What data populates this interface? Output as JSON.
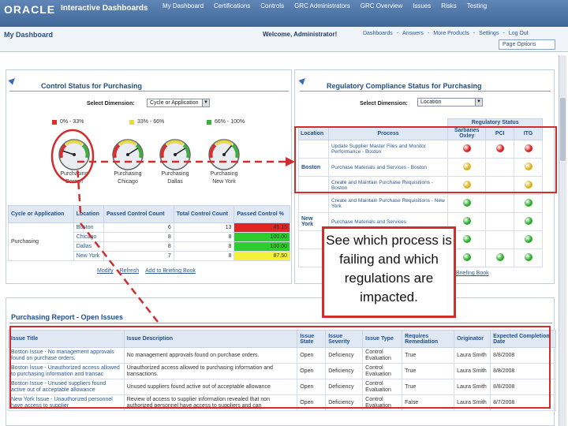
{
  "header": {
    "logo": "ORACLE",
    "app_title": "Interactive Dashboards",
    "nav": [
      "My Dashboard",
      "Certifications",
      "Controls",
      "GRC Administrators",
      "GRC Overview",
      "Issues",
      "Risks",
      "Testing"
    ]
  },
  "subheader": {
    "dashboard_title": "My Dashboard",
    "welcome": "Welcome, Administrator!",
    "links": [
      "Dashboards",
      "Answers",
      "More Products",
      "Settings",
      "Log Out"
    ],
    "page_options": "Page Options"
  },
  "control_panel": {
    "title": "Control Status for Purchasing",
    "select_label": "Select Dimension:",
    "select_value": "Cycle or Application",
    "legend": [
      {
        "label": "0% - 33%",
        "color": "#d9302c"
      },
      {
        "label": "33% - 66%",
        "color": "#e6d94a"
      },
      {
        "label": "66% - 100%",
        "color": "#3fae3f"
      }
    ],
    "gauges": [
      {
        "line1": "Purchasing",
        "line2": "Boston",
        "value": 0.1
      },
      {
        "line1": "Purchasing",
        "line2": "Chicago",
        "value": 0.82
      },
      {
        "line1": "Purchasing",
        "line2": "Dallas",
        "value": 0.82
      },
      {
        "line1": "Purchasing",
        "line2": "New York",
        "value": 0.72
      }
    ],
    "table": {
      "headers": [
        "Cycle or Application",
        "Location",
        "Passed Control Count",
        "Total Control Count",
        "Passed Control %"
      ],
      "cycle": "Purchasing",
      "rows": [
        {
          "location": "Boston",
          "passed": "6",
          "total": "13",
          "pct": "46.15",
          "color": "#e02424"
        },
        {
          "location": "Chicago",
          "passed": "8",
          "total": "8",
          "pct": "100.00",
          "color": "#2fcc2f"
        },
        {
          "location": "Dallas",
          "passed": "8",
          "total": "8",
          "pct": "100.00",
          "color": "#2fcc2f"
        },
        {
          "location": "New York",
          "passed": "7",
          "total": "8",
          "pct": "87.50",
          "color": "#f5f03a"
        }
      ]
    },
    "links": [
      "Modify",
      "Refresh",
      "Add to Briefing Book"
    ]
  },
  "regulatory_panel": {
    "title": "Regulatory Compliance Status for Purchasing",
    "select_label": "Select Dimension:",
    "select_value": "Location",
    "group_header": "Regulatory Status",
    "headers": [
      "Location",
      "Process",
      "Sarbanes Oxley",
      "PCI",
      "ITG"
    ],
    "colors": {
      "red": "#d61f1f",
      "yellow": "#d9b21c",
      "green": "#2caa2c"
    },
    "rows": [
      {
        "location": "",
        "process": "Update Supplier Master Files and Monitor Performance - Boston",
        "sox": "red",
        "pci": "red",
        "itg": "red"
      },
      {
        "location": "Boston",
        "process": "Purchase Materials and Services - Boston",
        "sox": "yellow",
        "pci": "",
        "itg": "yellow"
      },
      {
        "location": "",
        "process": "Create and Maintain Purchase Requisitions - Boston",
        "sox": "yellow",
        "pci": "",
        "itg": "yellow"
      },
      {
        "location": "",
        "process": "Create and Maintain Purchase Requisitions - New York",
        "sox": "green",
        "pci": "",
        "itg": "green"
      },
      {
        "location": "New York",
        "process": "Purchase Materials and Services",
        "sox": "green",
        "pci": "",
        "itg": "green"
      },
      {
        "location": "",
        "process": "",
        "sox": "green",
        "pci": "",
        "itg": "green"
      },
      {
        "location": "",
        "process": "",
        "sox": "green",
        "pci": "green",
        "itg": "green"
      }
    ],
    "link": "Briefing Book"
  },
  "callout": {
    "text": "See which process is failing and which regulations are impacted."
  },
  "issues_panel": {
    "title": "Purchasing Report - Open Issues",
    "headers": [
      "Issue Title",
      "Issue Description",
      "Issue State",
      "Issue Severity",
      "Issue Type",
      "Requires Remediation",
      "Originator",
      "Expected Completion Date"
    ],
    "rows": [
      [
        "Boston Issue - No management approvals found on purchase orders.",
        "No management approvals found on purchase orders.",
        "Open",
        "Deficiency",
        "Control Evaluation",
        "True",
        "Laura Smith",
        "8/8/2008"
      ],
      [
        "Boston Issue - Unauthorized access allowed to purchasing information and transac",
        "Unauthorized access allowed to purchasing information and transactions.",
        "Open",
        "Deficiency",
        "Control Evaluation",
        "True",
        "Laura Smith",
        "8/8/2008"
      ],
      [
        "Boston Issue - Unused suppliers found active out of acceptable allowance",
        "Unused suppliers found active out of acceptable allowance",
        "Open",
        "Deficiency",
        "Control Evaluation",
        "True",
        "Laura Smith",
        "8/8/2008"
      ],
      [
        "New York Issue - Unauthorized personnel have access to supplier",
        "Review of access to supplier information revealed that non authorized personnel have access to suppliers and can",
        "Open",
        "Deficiency",
        "Control Evaluation",
        "False",
        "Laura Smith",
        "8/7/2008"
      ]
    ]
  }
}
